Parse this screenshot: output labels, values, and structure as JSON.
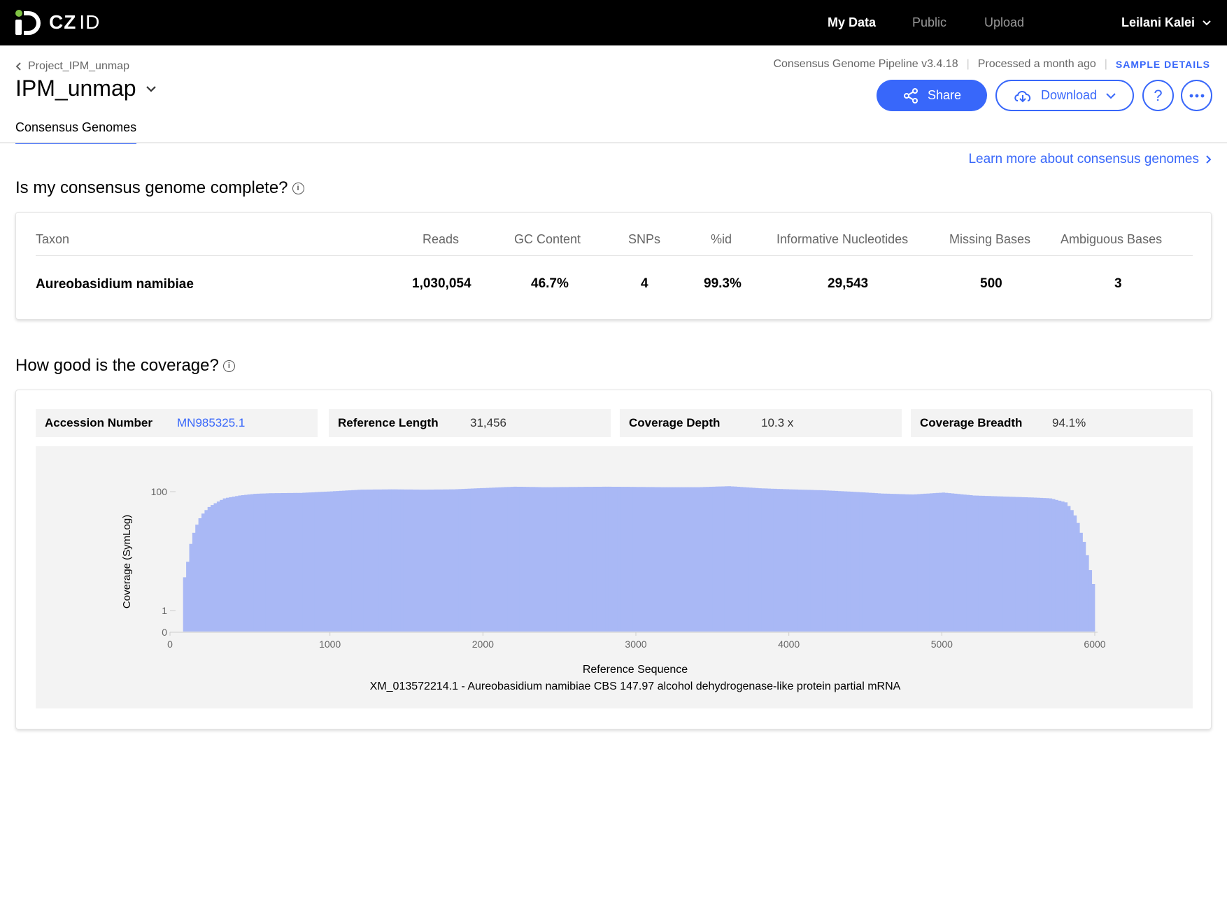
{
  "nav": {
    "logo_bold": "CZ",
    "logo_light": "ID",
    "items": [
      "My Data",
      "Public",
      "Upload"
    ],
    "user": "Leilani Kalei"
  },
  "header": {
    "breadcrumb": "Project_IPM_unmap",
    "title": "IPM_unmap",
    "pipeline": "Consensus Genome Pipeline v3.4.18",
    "processed": "Processed a month ago",
    "sample_details": "SAMPLE DETAILS",
    "share_label": "Share",
    "download_label": "Download",
    "help_label": "?",
    "tab": "Consensus Genomes"
  },
  "learn_more": "Learn more about consensus genomes",
  "complete_section": {
    "title": "Is my consensus genome complete?",
    "columns": [
      "Taxon",
      "Reads",
      "GC Content",
      "SNPs",
      "%id",
      "Informative Nucleotides",
      "Missing Bases",
      "Ambiguous Bases"
    ],
    "row": [
      "Aureobasidium namibiae",
      "1,030,054",
      "46.7%",
      "4",
      "99.3%",
      "29,543",
      "500",
      "3"
    ]
  },
  "coverage_section": {
    "title": "How good is the coverage?",
    "stats": [
      {
        "label": "Accession Number",
        "value": "MN985325.1"
      },
      {
        "label": "Reference Length",
        "value": "31,456"
      },
      {
        "label": "Coverage Depth",
        "value": "10.3 x"
      },
      {
        "label": "Coverage Breadth",
        "value": "94.1%"
      }
    ]
  },
  "colors": {
    "accent": "#3867fa",
    "bar": "#a9b8f5",
    "logo_dot": "#80c343"
  },
  "chart_data": {
    "type": "bar",
    "ylabel": "Coverage (SymLog)",
    "xlabel": "Reference Sequence",
    "subtitle": "XM_013572214.1 - Aureobasidium namibiae CBS 147.97 alcohol dehydrogenase-like protein partial mRNA",
    "yscale": "symlog",
    "y_ticks": [
      "0",
      "1",
      "100"
    ],
    "x_ticks": [
      0,
      1000,
      2000,
      3000,
      4000,
      5000,
      6000
    ],
    "xlim": [
      0,
      6000
    ],
    "x": [
      50,
      100,
      150,
      200,
      300,
      400,
      500,
      600,
      800,
      1000,
      1200,
      1400,
      1600,
      1800,
      2000,
      2200,
      2400,
      2600,
      2800,
      3000,
      3200,
      3400,
      3600,
      3800,
      4000,
      4200,
      4400,
      4600,
      4800,
      5000,
      5200,
      5400,
      5600,
      5700,
      5800,
      5850,
      5900,
      5950,
      6000
    ],
    "values": [
      5,
      25,
      45,
      60,
      80,
      88,
      93,
      95,
      96,
      101,
      107,
      108,
      107,
      108,
      113,
      118,
      116,
      117,
      118,
      117,
      116,
      116,
      120,
      112,
      108,
      105,
      100,
      94,
      91,
      97,
      88,
      85,
      82,
      80,
      70,
      50,
      25,
      8,
      1
    ]
  }
}
